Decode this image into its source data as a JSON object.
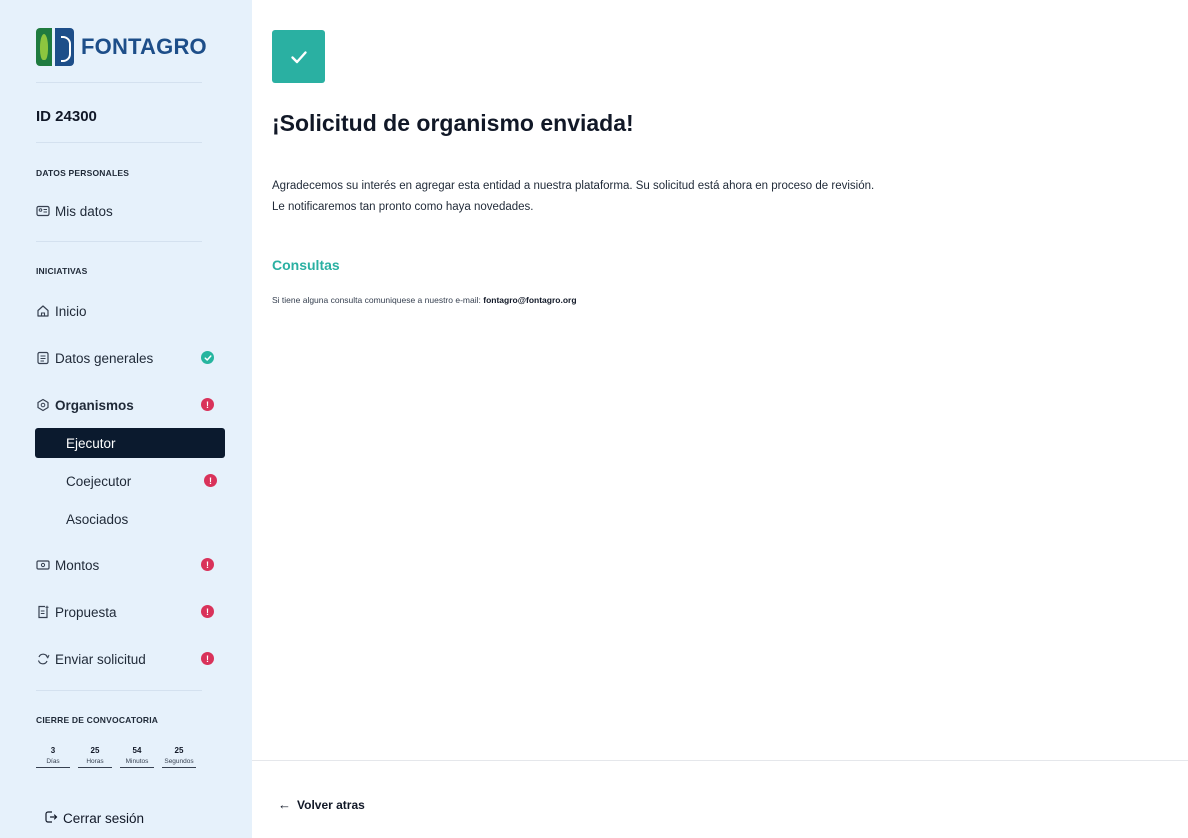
{
  "brand": {
    "name": "FONTAGRO"
  },
  "sidebar": {
    "id_label": "ID 24300",
    "sections": {
      "personal": "DATOS PERSONALES",
      "initiatives": "INICIATIVAS",
      "closing": "CIERRE DE CONVOCATORIA"
    },
    "items": {
      "mis_datos": "Mis datos",
      "inicio": "Inicio",
      "datos_generales": "Datos generales",
      "organismos": "Organismos",
      "ejecutor": "Ejecutor",
      "coejecutor": "Coejecutor",
      "asociados": "Asociados",
      "montos": "Montos",
      "propuesta": "Propuesta",
      "enviar_solicitud": "Enviar solicitud"
    },
    "countdown": [
      {
        "value": "3",
        "unit": "Días"
      },
      {
        "value": "25",
        "unit": "Horas"
      },
      {
        "value": "54",
        "unit": "Minutos"
      },
      {
        "value": "25",
        "unit": "Segundos"
      }
    ],
    "logout_label": "Cerrar sesión"
  },
  "main": {
    "title": "¡Solicitud de organismo enviada!",
    "body_line1": "Agradecemos su interés en agregar esta entidad a nuestra plataforma. Su solicitud está ahora en proceso de revisión.",
    "body_line2": "Le notificaremos tan pronto como haya novedades.",
    "consultas_title": "Consultas",
    "consultas_text": "Si tiene alguna consulta comuniquese a nuestro e-mail:",
    "consultas_email": "fontagro@fontagro.org",
    "back_label": "Volver atras"
  },
  "colors": {
    "accent": "#2ab0a2",
    "sidebar_bg": "#e6f1fb",
    "active_item_bg": "#0b1a2e",
    "success_badge": "#26b59f",
    "error_badge": "#d9325a",
    "brand_blue": "#1d4e89",
    "brand_green": "#1f7b3f"
  }
}
